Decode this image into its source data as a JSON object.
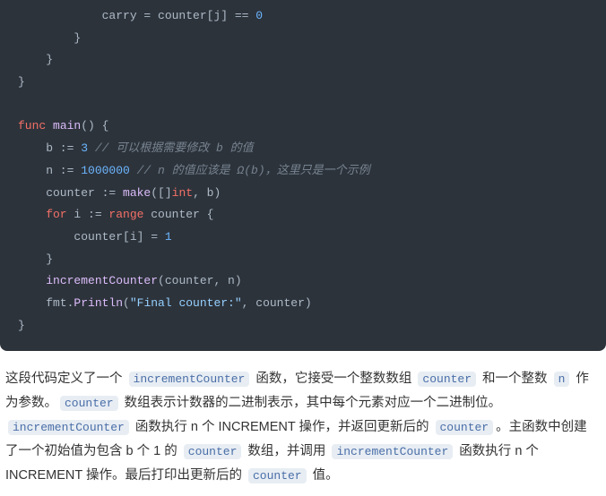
{
  "code": {
    "l1": "            carry = counter[j] == ",
    "l1_num": "0",
    "l2": "        }",
    "l3": "    }",
    "l4": "}",
    "l5_blank": "",
    "l6_func": "func",
    "l6_main": "main",
    "l6_paren": "() {",
    "l7_text": "    b := ",
    "l7_num": "3",
    "l7_comment": " // 可以根据需要修改 b 的值",
    "l8_text": "    n := ",
    "l8_num": "1000000",
    "l8_comment": " // n 的值应该是 Ω(b)，这里只是一个示例",
    "l9_a": "    counter := ",
    "l9_make": "make",
    "l9_b": "([]",
    "l9_int": "int",
    "l9_c": ", b)",
    "l10_for": "    for",
    "l10_rest": " i := ",
    "l10_range": "range",
    "l10_end": " counter {",
    "l11_a": "        counter[i] = ",
    "l11_num": "1",
    "l12": "    }",
    "l13_a": "    ",
    "l13_fn": "incrementCounter",
    "l13_b": "(counter, n)",
    "l14_a": "    fmt.",
    "l14_fn": "Println",
    "l14_b": "(",
    "l14_str": "\"Final counter:\"",
    "l14_c": ", counter)",
    "l15": "}"
  },
  "prose": {
    "t1": "这段代码定义了一个 ",
    "c1": "incrementCounter",
    "t2": " 函数，它接受一个整数数组 ",
    "c2": "counter",
    "t3": " 和一个整数 ",
    "c3": "n",
    "t4": " 作为参数。",
    "c4": "counter",
    "t5": " 数组表示计数器的二进制表示，其中每个元素对应一个二进制位。",
    "c5": "incrementCounter",
    "t6": " 函数执行 n 个 INCREMENT 操作，并返回更新后的 ",
    "c6": "counter",
    "t7": "。主函数中创建了一个初始值为包含 b 个 1 的 ",
    "c7": "counter",
    "t8": " 数组，并调用 ",
    "c8": "incrementCounter",
    "t9": " 函数执行 n 个 INCREMENT 操作。最后打印出更新后的 ",
    "c9": "counter",
    "t10": " 值。"
  }
}
